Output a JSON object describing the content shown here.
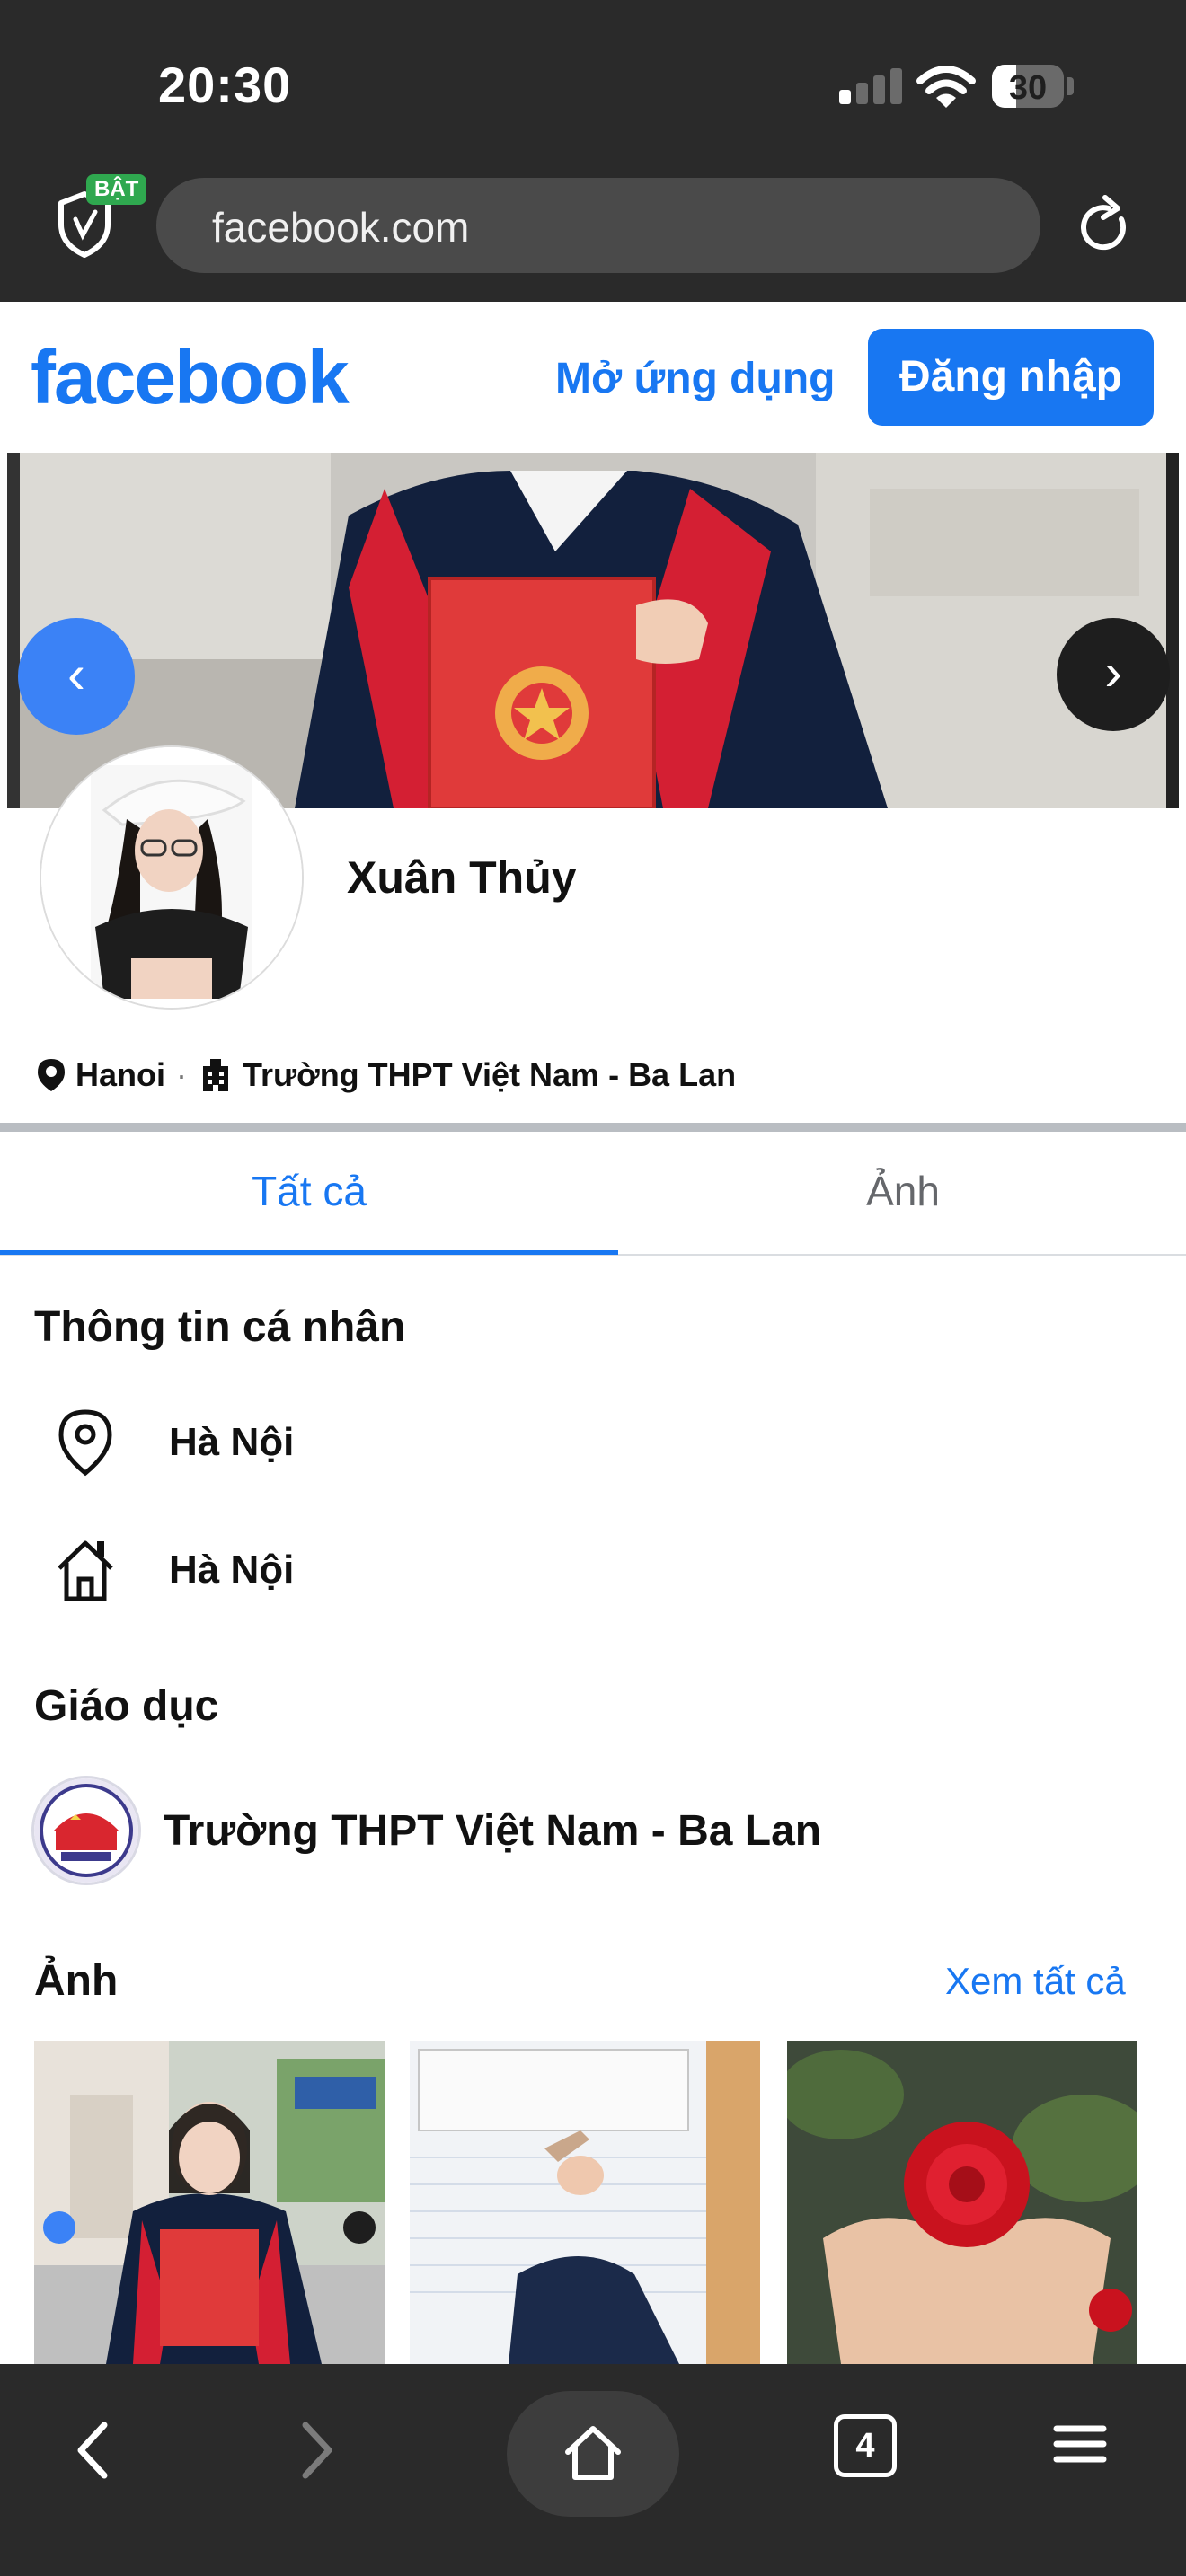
{
  "status_bar": {
    "time": "20:30",
    "battery": "30"
  },
  "browser": {
    "shield_badge": "BẬT",
    "url": "facebook.com",
    "open_tabs": "4"
  },
  "header": {
    "logo": "facebook",
    "open_app": "Mở ứng dụng",
    "login": "Đăng nhập"
  },
  "cover": {
    "prev_icon": "‹",
    "next_icon": "›"
  },
  "profile": {
    "name": "Xuân Thủy",
    "city": "Hanoi",
    "separator": "·",
    "school": "Trường THPT Việt Nam - Ba Lan"
  },
  "tabs": [
    {
      "label": "Tất cả",
      "active": true
    },
    {
      "label": "Ảnh",
      "active": false
    }
  ],
  "about": {
    "title": "Thông tin cá nhân",
    "lives_in": "Hà Nội",
    "hometown": "Hà Nội"
  },
  "education": {
    "title": "Giáo dục",
    "school": "Trường THPT Việt Nam - Ba Lan"
  },
  "photos": {
    "title": "Ảnh",
    "see_all": "Xem tất cả"
  },
  "colors": {
    "brand": "#1877f2",
    "chrome": "#2a2a2a",
    "text": "#111111",
    "muted": "#65676b"
  },
  "icons": [
    "shield-icon",
    "reload-icon",
    "location-pin-icon",
    "building-icon",
    "home-icon",
    "back-icon",
    "forward-icon",
    "tabs-icon",
    "menu-icon"
  ]
}
